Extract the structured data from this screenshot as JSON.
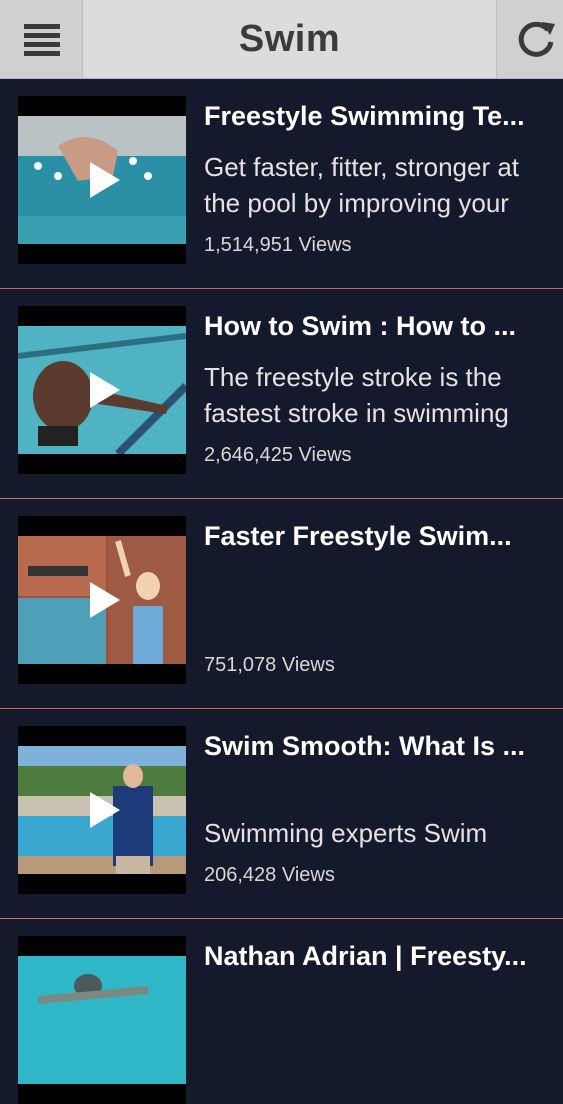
{
  "header": {
    "title": "Swim"
  },
  "videos": [
    {
      "title": "Freestyle Swimming Te...",
      "desc": "Get faster, fitter, stronger at the pool by improving your",
      "views": "1,514,951 Views"
    },
    {
      "title": "How to Swim : How to ...",
      "desc": "The freestyle stroke is the fastest stroke in swimming",
      "views": "2,646,425 Views"
    },
    {
      "title": "Faster Freestyle Swim...",
      "desc": "",
      "views": "751,078 Views"
    },
    {
      "title": "Swim Smooth: What Is ...",
      "desc": "Swimming experts Swim",
      "views": "206,428 Views"
    },
    {
      "title": "Nathan Adrian | Freesty...",
      "desc": "",
      "views": ""
    }
  ]
}
